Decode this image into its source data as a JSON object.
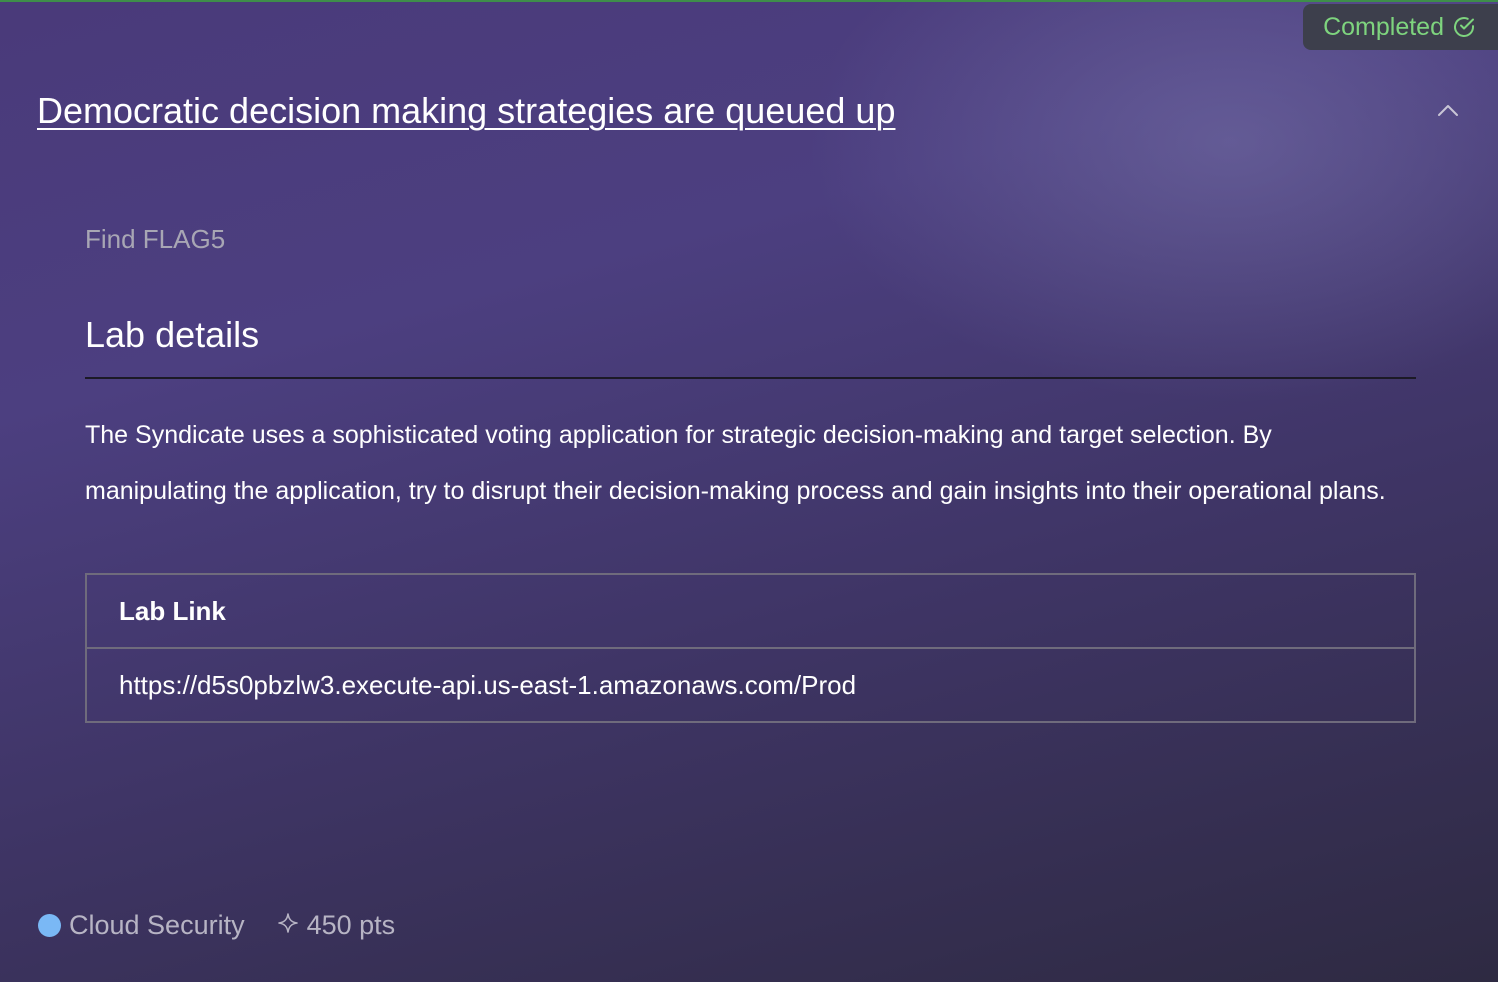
{
  "status": {
    "label": "Completed",
    "color": "#7ed47e",
    "icon": "check-circle-icon"
  },
  "challenge": {
    "title": "Democratic decision making strategies are queued up",
    "objective": "Find FLAG5",
    "collapse_icon": "chevron-up-icon"
  },
  "lab": {
    "section_title": "Lab details",
    "description": "The Syndicate uses a sophisticated voting application for strategic decision-making and target selection. By manipulating the application, try to disrupt their decision-making process and gain insights into their operational plans.",
    "table": {
      "header": "Lab Link",
      "value": "https://d5s0pbzlw3.execute-api.us-east-1.amazonaws.com/Prod"
    }
  },
  "footer": {
    "category": "Cloud Security",
    "category_color": "#7ab8f5",
    "points": "450 pts",
    "points_icon": "sparkle-icon"
  }
}
